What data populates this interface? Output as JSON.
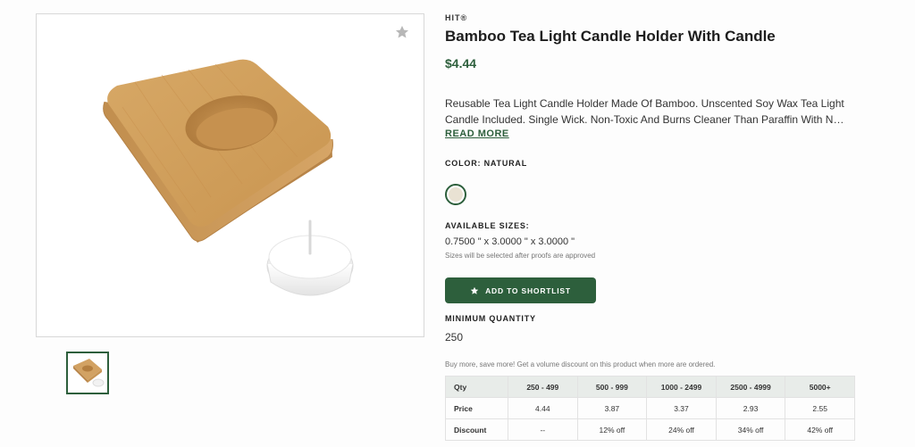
{
  "product": {
    "brand": "HIT®",
    "title": "Bamboo Tea Light Candle Holder With Candle",
    "price": "$4.44",
    "description_line1": "Reusable Tea Light Candle Holder Made Of Bamboo. Unscented Soy Wax Tea Light",
    "description_line2": "Candle Included. Single Wick. Non-Toxic And Burns Cleaner Than Paraffin With No...",
    "read_more": "READ MORE"
  },
  "color": {
    "label": "COLOR: NATURAL",
    "swatch_hex": "#e9e2d3"
  },
  "sizes": {
    "label": "AVAILABLE SIZES:",
    "value": "0.7500 \" x 3.0000 \" x 3.0000 \"",
    "note": "Sizes will be selected after proofs are approved"
  },
  "shortlist_button": {
    "label": "ADD TO SHORTLIST",
    "icon": "star-icon"
  },
  "minimum_quantity": {
    "label": "MINIMUM QUANTITY",
    "value": "250"
  },
  "volume_note": "Buy more, save more! Get a volume discount on this product when more are ordered.",
  "pricing_table": {
    "header": [
      "Qty",
      "250 - 499",
      "500 - 999",
      "1000 - 2499",
      "2500 - 4999",
      "5000+"
    ],
    "rows": [
      [
        "Price",
        "4.44",
        "3.87",
        "3.37",
        "2.93",
        "2.55"
      ],
      [
        "Discount",
        "--",
        "12% off",
        "24% off",
        "34% off",
        "42% off"
      ]
    ]
  },
  "colors": {
    "accent": "#2d5f3c",
    "table_header_bg": "#e8ece9"
  }
}
